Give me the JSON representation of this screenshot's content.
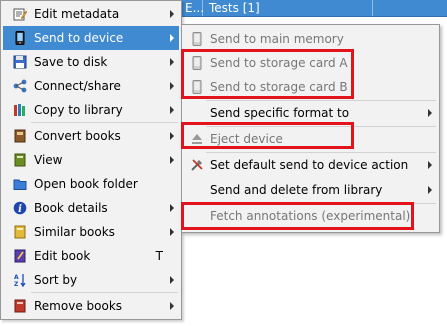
{
  "header": {
    "ellipsis": "E...",
    "tests": "Tests [1]"
  },
  "main_menu": {
    "items": [
      {
        "label": "Edit metadata",
        "icon": "edit-metadata-icon"
      },
      {
        "label": "Send to device",
        "icon": "device-icon"
      },
      {
        "label": "Save to disk",
        "icon": "save-disk-icon"
      },
      {
        "label": "Connect/share",
        "icon": "connect-share-icon"
      },
      {
        "label": "Copy to library",
        "icon": "copy-library-icon"
      },
      {
        "label": "Convert books",
        "icon": "convert-books-icon"
      },
      {
        "label": "View",
        "icon": "view-icon"
      },
      {
        "label": "Open book folder",
        "icon": "folder-icon"
      },
      {
        "label": "Book details",
        "icon": "info-icon"
      },
      {
        "label": "Similar books",
        "icon": "similar-books-icon"
      },
      {
        "label": "Edit book",
        "icon": "edit-book-icon",
        "shortcut": "T"
      },
      {
        "label": "Sort by",
        "icon": "sort-icon"
      },
      {
        "label": "Remove books",
        "icon": "remove-books-icon"
      }
    ]
  },
  "sub_menu": {
    "items": [
      {
        "label": "Send to main memory"
      },
      {
        "label": "Send to storage card A"
      },
      {
        "label": "Send to storage card B"
      },
      {
        "label": "Send specific format to"
      },
      {
        "label": "Eject device"
      },
      {
        "label": "Set default send to device action"
      },
      {
        "label": "Send and delete from library"
      },
      {
        "label": "Fetch annotations (experimental)"
      }
    ]
  },
  "colors": {
    "highlight": "#3f8ad1",
    "annotation": "#e3131e"
  }
}
